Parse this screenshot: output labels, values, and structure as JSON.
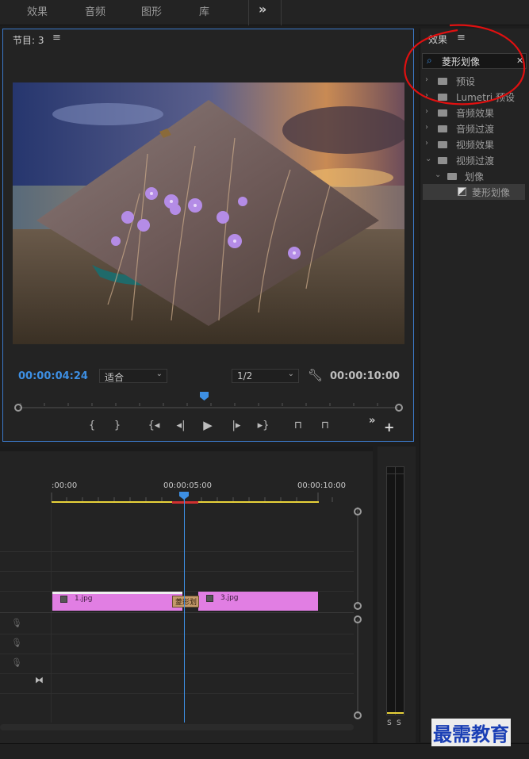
{
  "workspace_tabs": [
    "效果",
    "音频",
    "图形",
    "库"
  ],
  "overflow_glyph": "»",
  "program_monitor": {
    "title": "节目: 3",
    "menu_glyph": "≡",
    "current_time": "00:00:04:24",
    "fit_label": "适合",
    "resolution_label": "1/2",
    "duration": "00:00:10:00",
    "video_description_colors": {
      "sky": "#2a3c78",
      "sunset": "#e0a050",
      "flower": "#b48ce6"
    }
  },
  "effects_panel": {
    "title": "效果",
    "menu_glyph": "≡",
    "search_value": "菱形划像",
    "clear_glyph": "✕",
    "tree": [
      {
        "label": "预设",
        "arrow": "›",
        "level": 0,
        "icon": "preset-folder-icon"
      },
      {
        "label": "Lumetri 预设",
        "arrow": "›",
        "level": 0,
        "icon": "preset-folder-icon"
      },
      {
        "label": "音频效果",
        "arrow": "›",
        "level": 0,
        "icon": "folder-icon"
      },
      {
        "label": "音频过渡",
        "arrow": "›",
        "level": 0,
        "icon": "folder-icon"
      },
      {
        "label": "视频效果",
        "arrow": "›",
        "level": 0,
        "icon": "folder-icon"
      },
      {
        "label": "视频过渡",
        "arrow": "⌄",
        "level": 0,
        "icon": "folder-icon"
      },
      {
        "label": "划像",
        "arrow": "⌄",
        "level": 1,
        "icon": "folder-icon"
      },
      {
        "label": "菱形划像",
        "arrow": "",
        "level": 2,
        "icon": "transition-icon",
        "selected": true
      }
    ]
  },
  "timeline": {
    "ruler_labels": [
      ":00:00",
      "00:00:05:00",
      "00:00:10:00"
    ],
    "clips": [
      {
        "name": "1.jpg"
      },
      {
        "name": "3.jpg"
      }
    ],
    "transition_label": "菱形划"
  },
  "audio_meter": {
    "solo_labels": [
      "S",
      "S"
    ]
  },
  "watermark": "最需教育",
  "accent_color": "#3d8fe3",
  "annotation_color": "#e01010"
}
